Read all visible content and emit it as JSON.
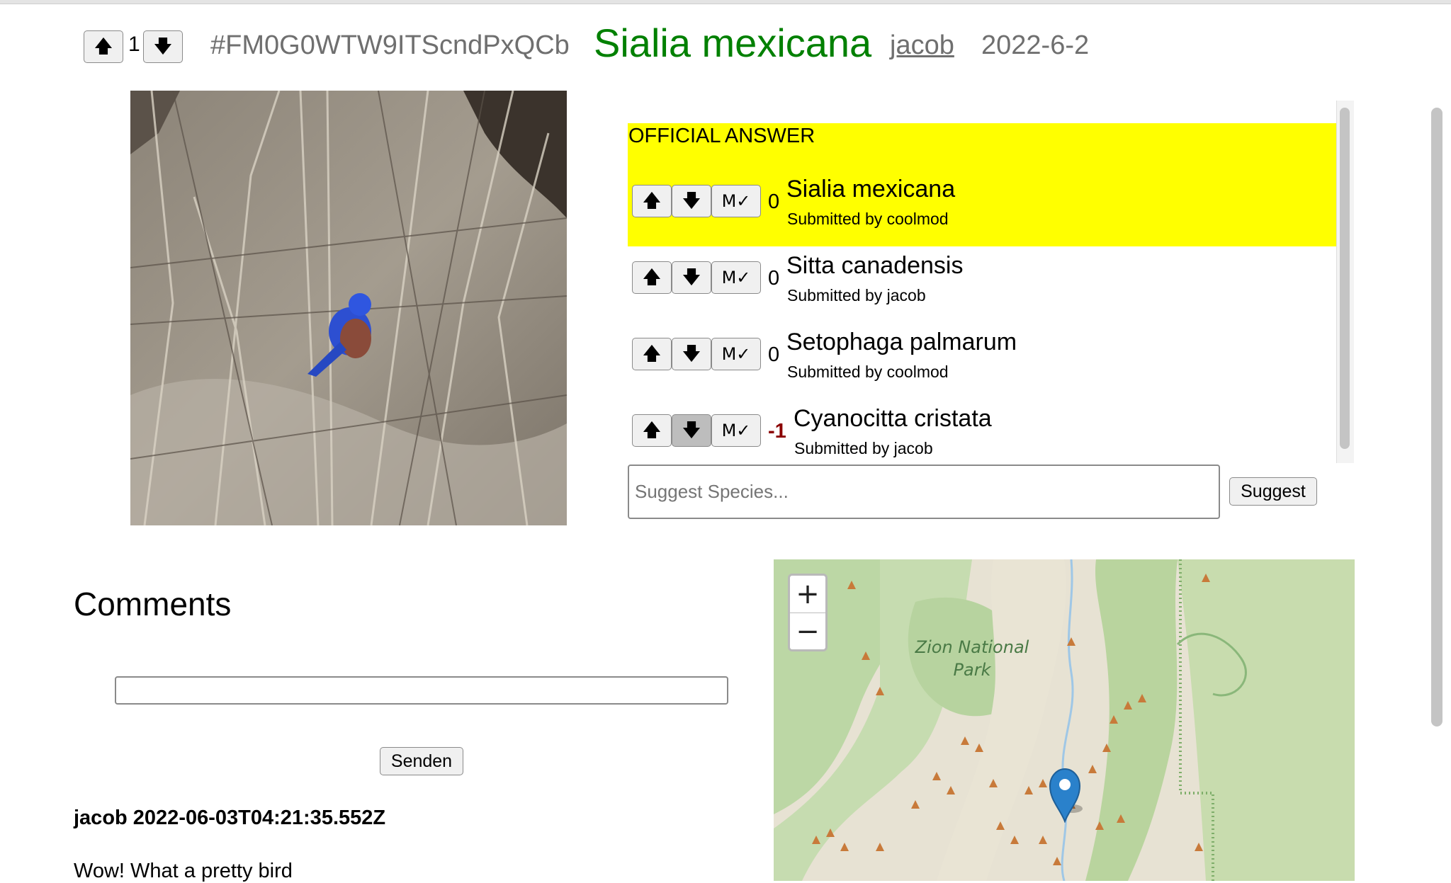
{
  "header": {
    "vote_up_icon": "arrow-up-icon",
    "vote_count": "1",
    "vote_down_icon": "arrow-down-icon",
    "observation_id": "#FM0G0WTW9ITScndPxQCb",
    "species": "Sialia mexicana",
    "user": "jacob",
    "date": "2022-6-2",
    "species_color": "#008000"
  },
  "answers": {
    "official_label": "OFFICIAL ANSWER",
    "highlight_color": "#ffff00",
    "up_arrow": "🡅",
    "down_arrow": "🡇",
    "mod_label": "M✓",
    "items": [
      {
        "species": "Sialia mexicana",
        "submitted": "Submitted by coolmod",
        "score": "0"
      },
      {
        "species": "Sitta canadensis",
        "submitted": "Submitted by jacob",
        "score": "0"
      },
      {
        "species": "Setophaga palmarum",
        "submitted": "Submitted by coolmod",
        "score": "0"
      },
      {
        "species": "Cyanocitta cristata",
        "submitted": "Submitted by jacob",
        "score": "-1"
      }
    ],
    "negative_score_color": "#8b0000"
  },
  "suggest": {
    "placeholder": "Suggest Species...",
    "button": "Suggest"
  },
  "comments": {
    "title": "Comments",
    "send_button": "Senden",
    "items": [
      {
        "header": "jacob 2022-06-03T04:21:35.552Z",
        "body": "Wow! What a pretty bird"
      }
    ]
  },
  "map": {
    "zoom_in": "+",
    "zoom_out": "−",
    "place_label_line1": "Zion National",
    "place_label_line2": "Park",
    "marker_icon": "map-pin-icon"
  }
}
